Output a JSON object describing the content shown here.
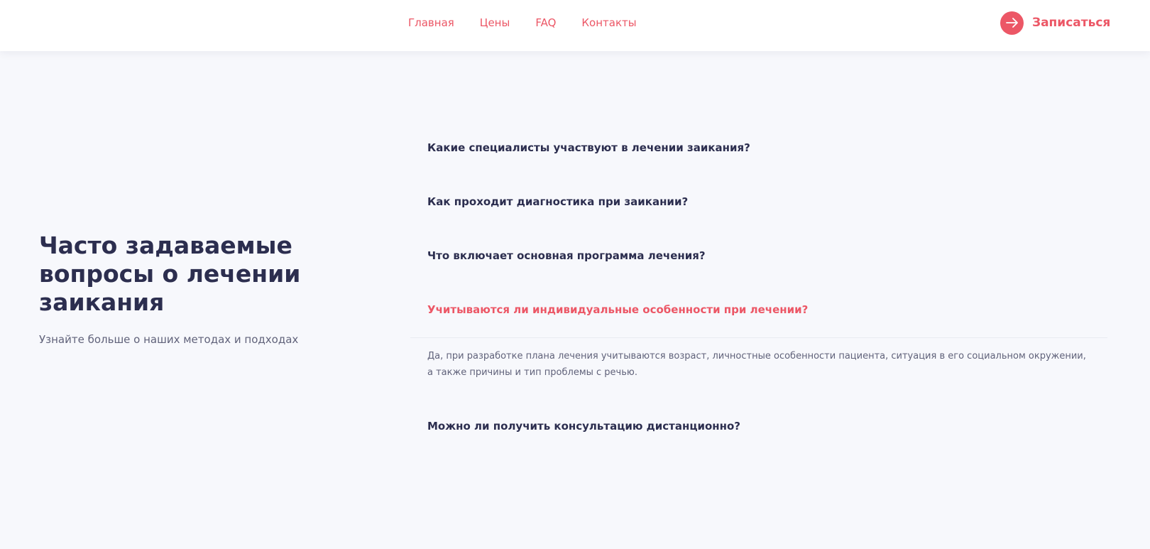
{
  "nav": {
    "items": [
      {
        "label": "Главная"
      },
      {
        "label": "Цены"
      },
      {
        "label": "FAQ"
      },
      {
        "label": "Контакты"
      }
    ],
    "cta": {
      "label": "Записаться",
      "icon": "arrow-right-icon"
    }
  },
  "intro": {
    "title": "Часто задаваемые вопросы о лечении заикания",
    "subtitle": "Узнайте больше о наших методах и подходах"
  },
  "faq": {
    "items": [
      {
        "question": "Какие специалисты участвуют в лечении заикания?",
        "expanded": false
      },
      {
        "question": "Как проходит диагностика при заикании?",
        "expanded": false
      },
      {
        "question": "Что включает основная программа лечения?",
        "expanded": false
      },
      {
        "question": "Учитываются ли индивидуальные особенности при лечении?",
        "expanded": true,
        "answer": "Да, при разработке плана лечения учитываются возраст, личностные особенности пациента, ситуация в его социальном окружении, а также причины и тип проблемы с речью."
      },
      {
        "question": "Можно ли получить консультацию дистанционно?",
        "expanded": false
      }
    ]
  },
  "colors": {
    "accent": "#ec5766",
    "heading": "#2c2e4f",
    "body_text": "#60627a",
    "page_background": "#f7f8fc",
    "header_background": "#ffffff"
  }
}
